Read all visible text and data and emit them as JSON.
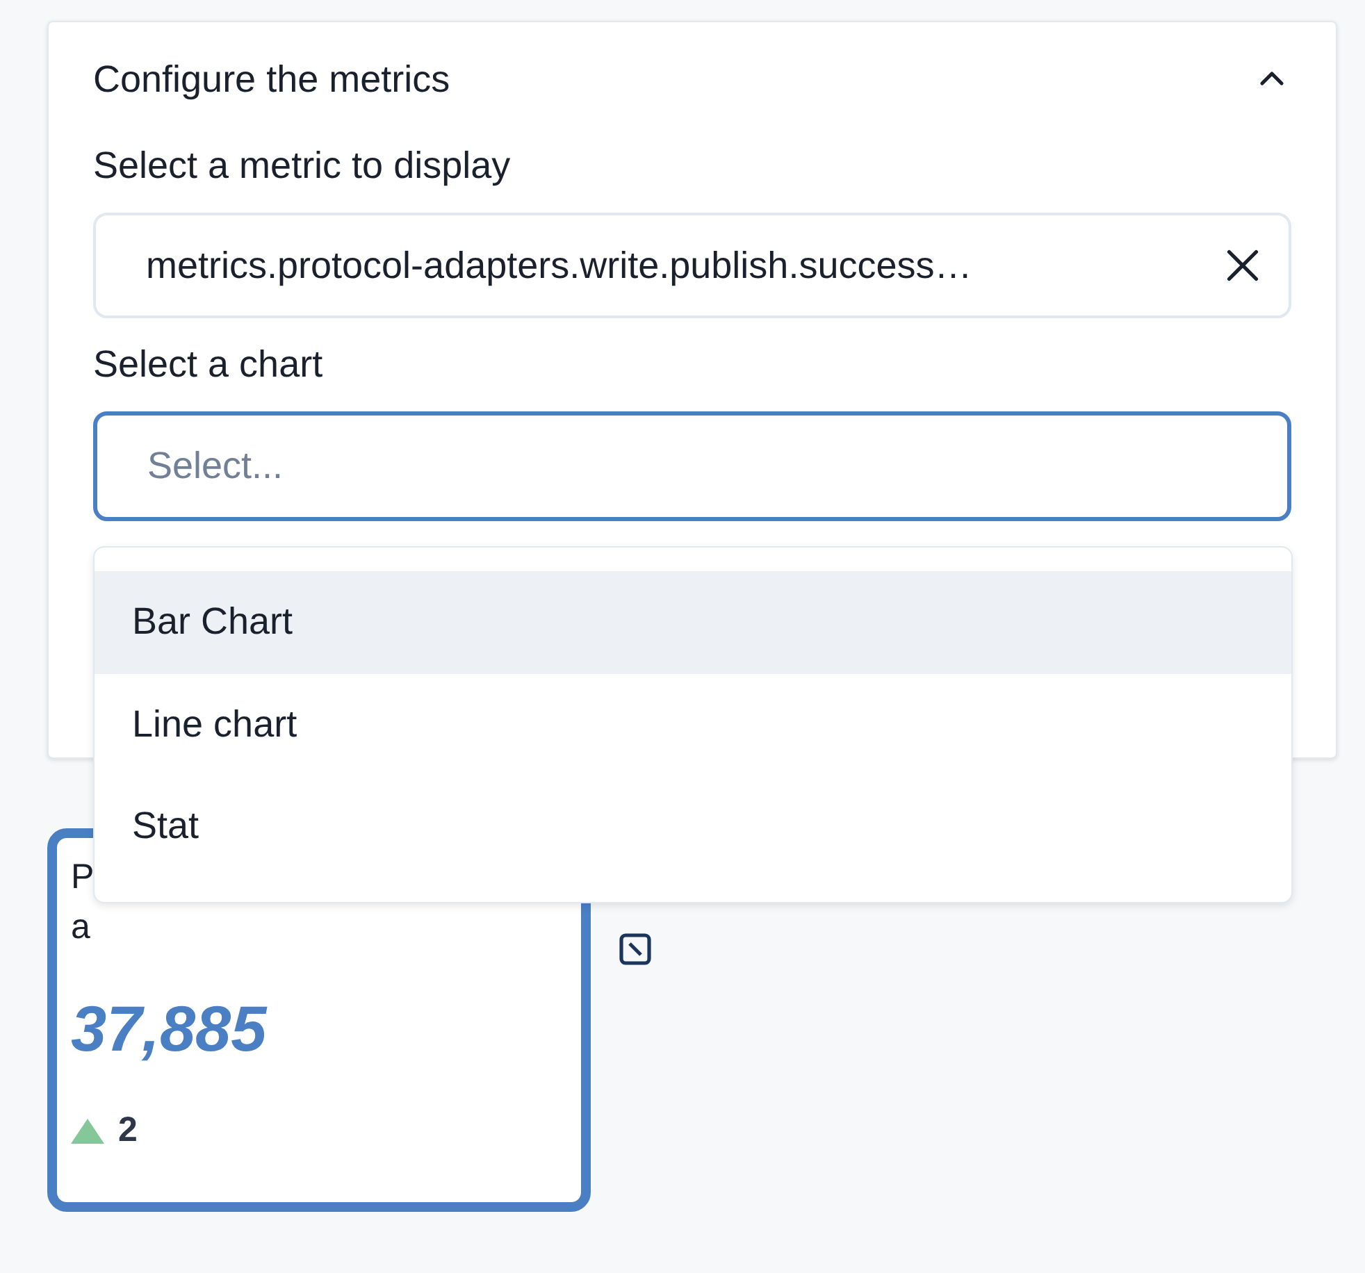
{
  "panel": {
    "title": "Configure the metrics",
    "expanded": true,
    "metric_label": "Select a metric to display",
    "metric_value": "metrics.protocol-adapters.write.publish.success…",
    "chart_label": "Select a chart",
    "chart_placeholder": "Select...",
    "chart_options": [
      {
        "label": "Bar Chart",
        "selected": true
      },
      {
        "label": "Line chart",
        "selected": false
      },
      {
        "label": "Stat",
        "selected": false
      }
    ]
  },
  "stat_card": {
    "title_line_1": "P",
    "title_line_2": "a",
    "value": "37,885",
    "rising": true,
    "change": "2"
  }
}
